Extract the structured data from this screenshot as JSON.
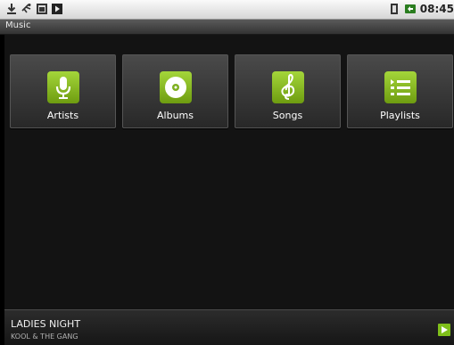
{
  "status_bar": {
    "icons": [
      "download-icon",
      "usb-icon",
      "sd-card-icon",
      "media-playing-icon"
    ],
    "right_icons": [
      "signal-icon",
      "battery-icon"
    ],
    "time": "08:45"
  },
  "app": {
    "title": "Music"
  },
  "tiles": [
    {
      "label": "Artists",
      "icon": "microphone-icon"
    },
    {
      "label": "Albums",
      "icon": "disc-icon"
    },
    {
      "label": "Songs",
      "icon": "treble-clef-icon"
    },
    {
      "label": "Playlists",
      "icon": "playlist-icon"
    }
  ],
  "now_playing": {
    "title": "LADIES NIGHT",
    "artist": "KOOL & THE GANG",
    "play_icon": "play-icon"
  },
  "colors": {
    "accent": "#8bc12a",
    "background": "#131313"
  }
}
